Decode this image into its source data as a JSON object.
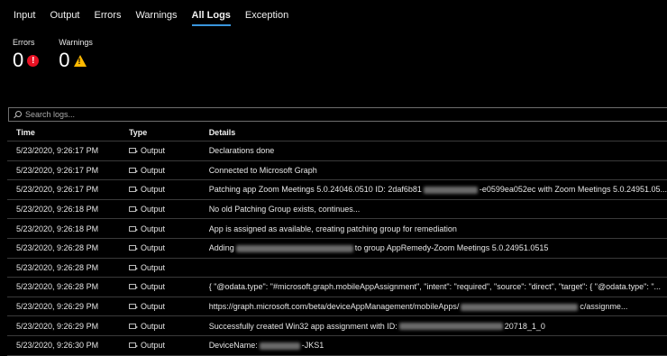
{
  "tabs": [
    "Input",
    "Output",
    "Errors",
    "Warnings",
    "All Logs",
    "Exception"
  ],
  "active_tab": "All Logs",
  "counters": {
    "errors_label": "Errors",
    "errors_value": "0",
    "warnings_label": "Warnings",
    "warnings_value": "0"
  },
  "search": {
    "placeholder": "Search logs..."
  },
  "table": {
    "headers": {
      "time": "Time",
      "type": "Type",
      "details": "Details"
    },
    "rows": [
      {
        "time": "5/23/2020, 9:26:17 PM",
        "type": "Output",
        "details": "Declarations done"
      },
      {
        "time": "5/23/2020, 9:26:17 PM",
        "type": "Output",
        "details": "Connected to Microsoft Graph"
      },
      {
        "time": "5/23/2020, 9:26:17 PM",
        "type": "Output",
        "details_pre": "Patching app Zoom Meetings 5.0.24046.0510 ID: 2daf6b81",
        "details_post": "-e0599ea052ec with Zoom Meetings 5.0.24951.05..."
      },
      {
        "time": "5/23/2020, 9:26:18 PM",
        "type": "Output",
        "details": "No old Patching Group exists, continues..."
      },
      {
        "time": "5/23/2020, 9:26:18 PM",
        "type": "Output",
        "details": "App is assigned as available, creating patching group for remediation"
      },
      {
        "time": "5/23/2020, 9:26:28 PM",
        "type": "Output",
        "details_pre": "Adding",
        "details_post": "to group AppRemedy-Zoom Meetings 5.0.24951.0515"
      },
      {
        "time": "5/23/2020, 9:26:28 PM",
        "type": "Output",
        "details": ""
      },
      {
        "time": "5/23/2020, 9:26:28 PM",
        "type": "Output",
        "details": "{ \"@odata.type\": \"#microsoft.graph.mobileAppAssignment\", \"intent\": \"required\", \"source\": \"direct\", \"target\": { \"@odata.type\": \"..."
      },
      {
        "time": "5/23/2020, 9:26:29 PM",
        "type": "Output",
        "details_pre": "https://graph.microsoft.com/beta/deviceAppManagement/mobileApps/",
        "details_post": "c/assignme..."
      },
      {
        "time": "5/23/2020, 9:26:29 PM",
        "type": "Output",
        "details_pre": "Successfully created Win32 app assignment with ID:",
        "details_post": "20718_1_0"
      },
      {
        "time": "5/23/2020, 9:26:30 PM",
        "type": "Output",
        "details_pre": "DeviceName:",
        "details_post": "-JKS1"
      }
    ]
  }
}
